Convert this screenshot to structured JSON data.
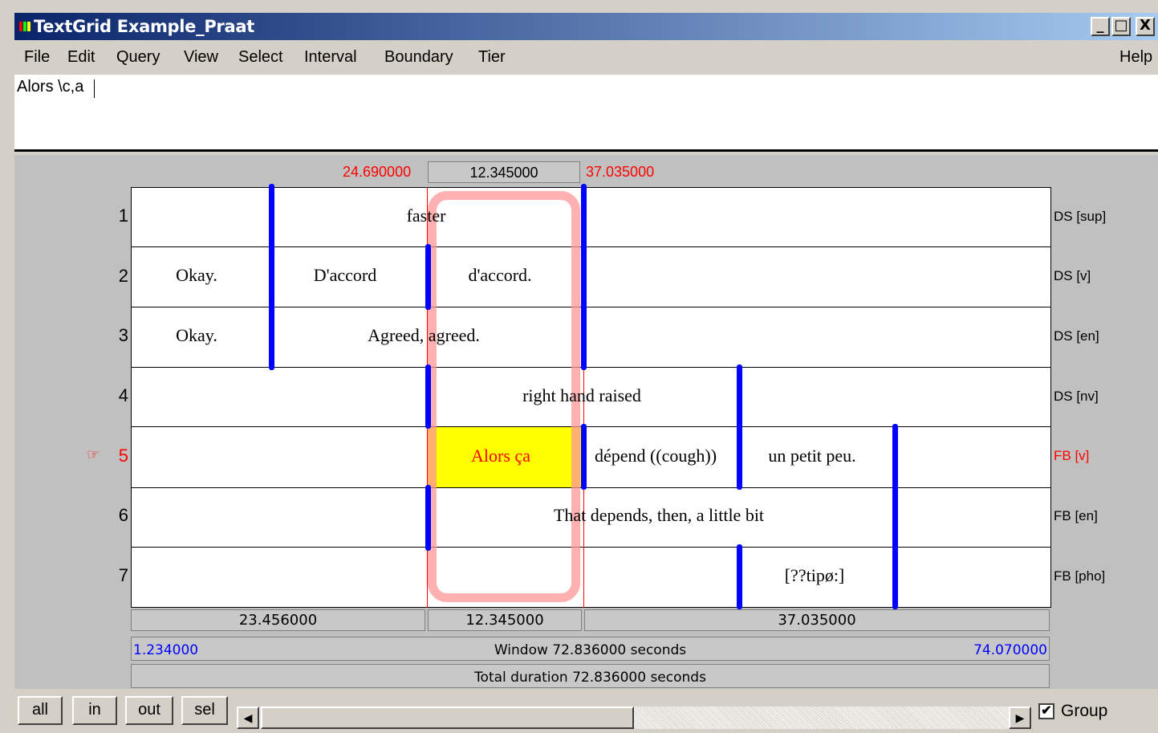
{
  "window": {
    "title": "TextGrid Example_Praat",
    "controls": {
      "minimize": "_",
      "maximize": "□",
      "close": "X"
    }
  },
  "menu": {
    "items": [
      "File",
      "Edit",
      "Query",
      "View",
      "Select",
      "Interval",
      "Boundary",
      "Tier"
    ],
    "help": "Help"
  },
  "text_field": {
    "value": "Alors \\c,a"
  },
  "selection": {
    "start": "24.690000",
    "duration": "12.345000",
    "end": "37.035000"
  },
  "tiers": [
    {
      "number": "1",
      "name": "DS [sup]",
      "active": false,
      "intervals": [
        "faster"
      ]
    },
    {
      "number": "2",
      "name": "DS [v]",
      "active": false,
      "intervals": [
        "Okay.",
        "D'accord",
        "d'accord."
      ]
    },
    {
      "number": "3",
      "name": "DS [en]",
      "active": false,
      "intervals": [
        "Okay.",
        "Agreed, agreed."
      ]
    },
    {
      "number": "4",
      "name": "DS [nv]",
      "active": false,
      "intervals": [
        "right hand raised"
      ]
    },
    {
      "number": "5",
      "name": "FB [v]",
      "active": true,
      "intervals": [
        "Alors ça",
        "dépend ((cough))",
        "un petit peu."
      ]
    },
    {
      "number": "6",
      "name": "FB [en]",
      "active": false,
      "intervals": [
        "That depends, then, a little bit"
      ]
    },
    {
      "number": "7",
      "name": "FB [pho]",
      "active": false,
      "intervals": [
        "[??tipø:]"
      ]
    }
  ],
  "active_tier_marker": "☞",
  "duration_bar": {
    "before": "23.456000",
    "selected": "12.345000",
    "after": "37.035000"
  },
  "window_bar": {
    "start": "1.234000",
    "label": "Window 72.836000 seconds",
    "end": "74.070000"
  },
  "total_bar": {
    "label": "Total duration 72.836000 seconds"
  },
  "buttons": {
    "all": "all",
    "in": "in",
    "out": "out",
    "sel": "sel"
  },
  "scroll": {
    "left_arrow": "◀",
    "right_arrow": "▶"
  },
  "group": {
    "label": "Group",
    "checked": true,
    "check_mark": "✔"
  },
  "colors": {
    "boundary": "#0000ff",
    "selection_highlight": "#ffff00",
    "active_text": "#ff0000",
    "time_link": "#0000ff"
  }
}
